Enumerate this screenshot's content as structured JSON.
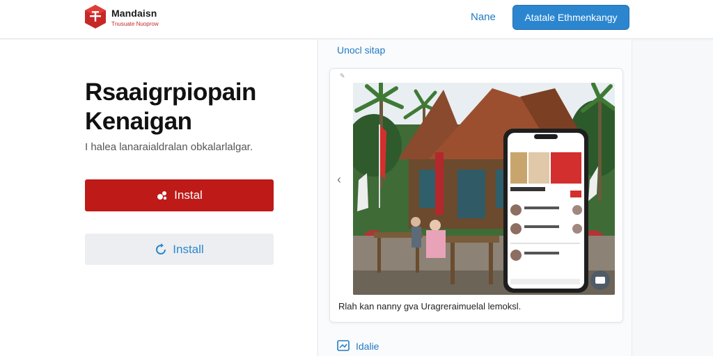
{
  "header": {
    "brand_name": "Mandaisn",
    "brand_tagline": "Tnusuate Nuoprow",
    "nav_link": "Nane",
    "cta_button": "Atatale Ethmenkangy"
  },
  "hero": {
    "title_line1": "Rsaaigrpiopain",
    "title_line2": "Kenaigan",
    "subtitle": "I halea lanaraialdralan obkalarlalgar.",
    "primary_button": "Instal",
    "secondary_button": "Install"
  },
  "preview": {
    "section_label": "Unocl sitap",
    "caption": "Rlah kan nanny gva Uragreraimuelal lemoksl.",
    "bottom_label": "Idalie"
  },
  "colors": {
    "primary_red": "#bd1a18",
    "accent_blue": "#2b86cf"
  },
  "icons": [
    "logo-icon",
    "sparkle-icon",
    "refresh-icon",
    "chevron-left-icon",
    "gallery-icon"
  ]
}
